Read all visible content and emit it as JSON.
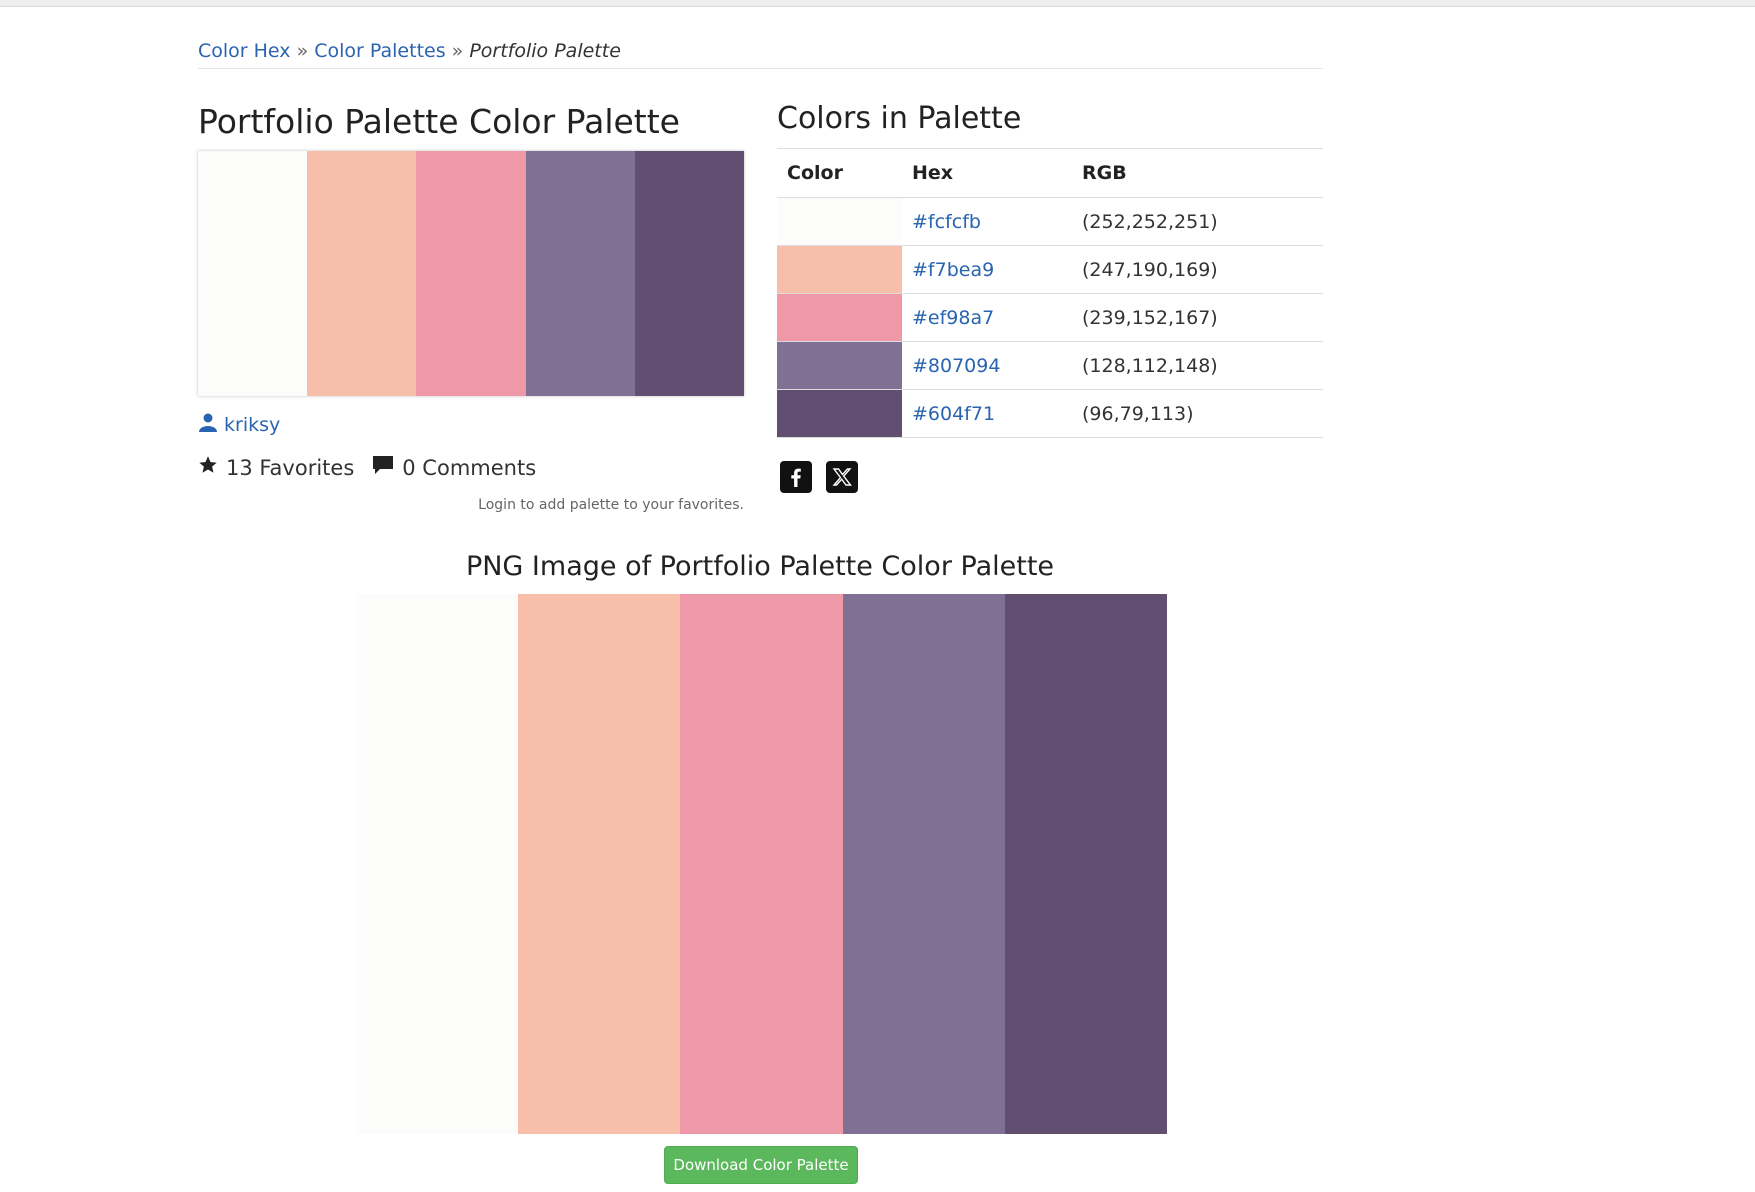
{
  "breadcrumb": {
    "items": [
      {
        "label": "Color Hex"
      },
      {
        "label": "Color Palettes"
      }
    ],
    "separator": "»",
    "current": "Portfolio Palette"
  },
  "palette": {
    "title": "Portfolio Palette Color Palette",
    "colors": [
      "#fcfcfb",
      "#f7bea9",
      "#ef98a7",
      "#807094",
      "#604f71"
    ]
  },
  "author": {
    "name": "kriksy",
    "icon": "user-icon"
  },
  "stats": {
    "favorites": "13 Favorites",
    "favorites_icon": "star-icon",
    "comments": "0 Comments",
    "comments_icon": "comment-icon"
  },
  "login_note": "Login to add palette to your favorites.",
  "colors_section": {
    "title": "Colors in Palette",
    "headers": {
      "color": "Color",
      "hex": "Hex",
      "rgb": "RGB"
    },
    "rows": [
      {
        "color": "#fcfcfb",
        "hex": "#fcfcfb",
        "rgb": "(252,252,251)"
      },
      {
        "color": "#f7bea9",
        "hex": "#f7bea9",
        "rgb": "(247,190,169)"
      },
      {
        "color": "#ef98a7",
        "hex": "#ef98a7",
        "rgb": "(239,152,167)"
      },
      {
        "color": "#807094",
        "hex": "#807094",
        "rgb": "(128,112,148)"
      },
      {
        "color": "#604f71",
        "hex": "#604f71",
        "rgb": "(96,79,113)"
      }
    ]
  },
  "social": {
    "icons": [
      "facebook-icon",
      "x-twitter-icon"
    ]
  },
  "png_section": {
    "title": "PNG Image of Portfolio Palette Color Palette"
  },
  "download_button": "Download Color Palette",
  "theme": {
    "link_color": "#2a64b0",
    "button_color": "#5cb85c"
  }
}
